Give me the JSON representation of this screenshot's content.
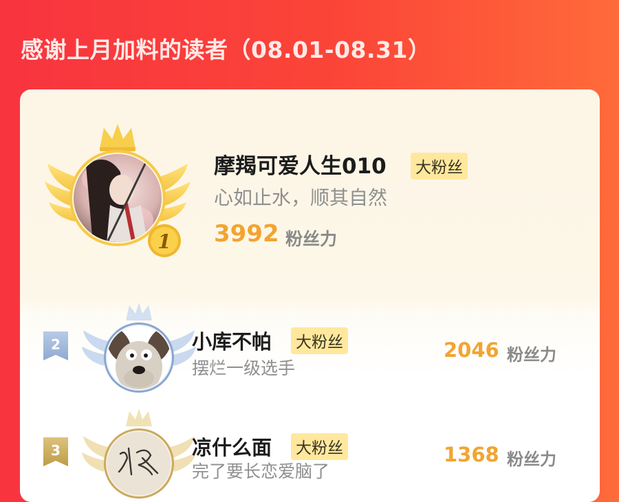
{
  "page": {
    "title": "感谢上月加料的读者（08.01-08.31）"
  },
  "readers": [
    {
      "rank": "1",
      "name": "摩羯可爱人生010",
      "badge": "大粉丝",
      "motto": "心如止水，顺其自然",
      "score": "3992",
      "unit": "粉丝力"
    },
    {
      "rank": "2",
      "name": "小库不帕",
      "badge": "大粉丝",
      "motto": "摆烂一级选手",
      "score": "2046",
      "unit": "粉丝力"
    },
    {
      "rank": "3",
      "name": "凉什么面",
      "badge": "大粉丝",
      "motto": "完了要长恋爱脑了",
      "score": "1368",
      "unit": "粉丝力"
    }
  ],
  "colors": {
    "background_left": "#f8343f",
    "background_right": "#ff6b3a",
    "gold": "#f2a431",
    "badge_bg": "#ffe89e",
    "silver": "#9fb7d8",
    "bronze": "#c8a85a"
  },
  "icons": [
    "crown-icon",
    "wings-icon",
    "rank-medal-icon",
    "rank-tag-icon"
  ]
}
